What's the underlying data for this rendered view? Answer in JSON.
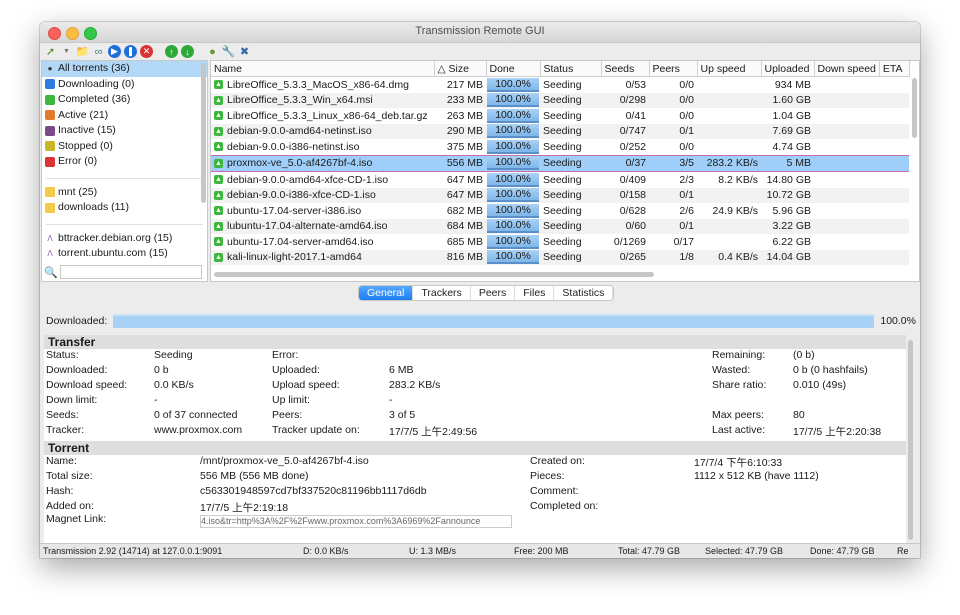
{
  "window": {
    "title": "Transmission Remote GUI"
  },
  "toolbar": {
    "icons": [
      "add-torrent-icon",
      "dropdown-arrow-icon",
      "add-folder-icon",
      "add-link-icon",
      "start-icon",
      "pause-icon",
      "remove-icon",
      "move-up-icon",
      "move-down-icon",
      "turtle-mode-icon",
      "connection-options-icon",
      "settings-icon"
    ]
  },
  "sidebar": {
    "status_filters": [
      {
        "label": "All torrents (36)",
        "icon": "all-icon",
        "color": "#333333"
      },
      {
        "label": "Downloading (0)",
        "icon": "download-icon",
        "color": "#2e7be0"
      },
      {
        "label": "Completed (36)",
        "icon": "completed-icon",
        "color": "#3cb93c"
      },
      {
        "label": "Active (21)",
        "icon": "active-icon",
        "color": "#e07b2e"
      },
      {
        "label": "Inactive (15)",
        "icon": "inactive-icon",
        "color": "#7a4a8a"
      },
      {
        "label": "Stopped (0)",
        "icon": "stopped-icon",
        "color": "#c8b52a"
      },
      {
        "label": "Error (0)",
        "icon": "error-icon",
        "color": "#d93333"
      }
    ],
    "folders": [
      {
        "label": "mnt (25)"
      },
      {
        "label": "downloads (11)"
      }
    ],
    "trackers": [
      {
        "label": "bttracker.debian.org (15)"
      },
      {
        "label": "torrent.ubuntu.com (15)"
      }
    ],
    "search": {
      "value": "",
      "placeholder": ""
    }
  },
  "torrents": {
    "columns": [
      "Name",
      "△ Size",
      "Done",
      "Status",
      "Seeds",
      "Peers",
      "Up speed",
      "Uploaded",
      "Down speed",
      "ETA"
    ],
    "rows": [
      {
        "name": "LibreOffice_5.3.3_MacOS_x86-64.dmg",
        "size": "217 MB",
        "done": "100.0%",
        "status": "Seeding",
        "seeds": "0/53",
        "peers": "0/0",
        "up": "",
        "uploaded": "934 MB",
        "down": "",
        "eta": ""
      },
      {
        "name": "LibreOffice_5.3.3_Win_x64.msi",
        "size": "233 MB",
        "done": "100.0%",
        "status": "Seeding",
        "seeds": "0/298",
        "peers": "0/0",
        "up": "",
        "uploaded": "1.60 GB",
        "down": "",
        "eta": ""
      },
      {
        "name": "LibreOffice_5.3.3_Linux_x86-64_deb.tar.gz",
        "size": "263 MB",
        "done": "100.0%",
        "status": "Seeding",
        "seeds": "0/41",
        "peers": "0/0",
        "up": "",
        "uploaded": "1.04 GB",
        "down": "",
        "eta": ""
      },
      {
        "name": "debian-9.0.0-amd64-netinst.iso",
        "size": "290 MB",
        "done": "100.0%",
        "status": "Seeding",
        "seeds": "0/747",
        "peers": "0/1",
        "up": "",
        "uploaded": "7.69 GB",
        "down": "",
        "eta": ""
      },
      {
        "name": "debian-9.0.0-i386-netinst.iso",
        "size": "375 MB",
        "done": "100.0%",
        "status": "Seeding",
        "seeds": "0/252",
        "peers": "0/0",
        "up": "",
        "uploaded": "4.74 GB",
        "down": "",
        "eta": ""
      },
      {
        "name": "proxmox-ve_5.0-af4267bf-4.iso",
        "size": "556 MB",
        "done": "100.0%",
        "status": "Seeding",
        "seeds": "0/37",
        "peers": "3/5",
        "up": "283.2 KB/s",
        "uploaded": "5 MB",
        "down": "",
        "eta": "",
        "selected": true
      },
      {
        "name": "debian-9.0.0-amd64-xfce-CD-1.iso",
        "size": "647 MB",
        "done": "100.0%",
        "status": "Seeding",
        "seeds": "0/409",
        "peers": "2/3",
        "up": "8.2 KB/s",
        "uploaded": "14.80 GB",
        "down": "",
        "eta": ""
      },
      {
        "name": "debian-9.0.0-i386-xfce-CD-1.iso",
        "size": "647 MB",
        "done": "100.0%",
        "status": "Seeding",
        "seeds": "0/158",
        "peers": "0/1",
        "up": "",
        "uploaded": "10.72 GB",
        "down": "",
        "eta": ""
      },
      {
        "name": "ubuntu-17.04-server-i386.iso",
        "size": "682 MB",
        "done": "100.0%",
        "status": "Seeding",
        "seeds": "0/628",
        "peers": "2/6",
        "up": "24.9 KB/s",
        "uploaded": "5.96 GB",
        "down": "",
        "eta": ""
      },
      {
        "name": "lubuntu-17.04-alternate-amd64.iso",
        "size": "684 MB",
        "done": "100.0%",
        "status": "Seeding",
        "seeds": "0/60",
        "peers": "0/1",
        "up": "",
        "uploaded": "3.22 GB",
        "down": "",
        "eta": ""
      },
      {
        "name": "ubuntu-17.04-server-amd64.iso",
        "size": "685 MB",
        "done": "100.0%",
        "status": "Seeding",
        "seeds": "0/1269",
        "peers": "0/17",
        "up": "",
        "uploaded": "6.22 GB",
        "down": "",
        "eta": ""
      },
      {
        "name": "kali-linux-light-2017.1-amd64",
        "size": "816 MB",
        "done": "100.0%",
        "status": "Seeding",
        "seeds": "0/265",
        "peers": "1/8",
        "up": "0.4 KB/s",
        "uploaded": "14.04 GB",
        "down": "",
        "eta": ""
      }
    ]
  },
  "tabs": [
    {
      "label": "General",
      "active": true
    },
    {
      "label": "Trackers",
      "active": false
    },
    {
      "label": "Peers",
      "active": false
    },
    {
      "label": "Files",
      "active": false
    },
    {
      "label": "Statistics",
      "active": false
    }
  ],
  "downloaded": {
    "label": "Downloaded:",
    "percent_text": "100.0%",
    "fraction": 1.0
  },
  "transfer": {
    "title": "Transfer",
    "status_label": "Status:",
    "status": "Seeding",
    "downloaded_label": "Downloaded:",
    "downloaded": "0 b",
    "download_speed_label": "Download speed:",
    "download_speed": "0.0 KB/s",
    "down_limit_label": "Down limit:",
    "down_limit": "-",
    "seeds_label": "Seeds:",
    "seeds": "0 of 37 connected",
    "tracker_label": "Tracker:",
    "tracker": "www.proxmox.com",
    "error_label": "Error:",
    "error": "",
    "uploaded_label": "Uploaded:",
    "uploaded": "6 MB",
    "upload_speed_label": "Upload speed:",
    "upload_speed": "283.2 KB/s",
    "up_limit_label": "Up limit:",
    "up_limit": "-",
    "peers_label": "Peers:",
    "peers": "3 of 5",
    "tracker_update_label": "Tracker update on:",
    "tracker_update": "17/7/5  上午2:49:56",
    "remaining_label": "Remaining:",
    "remaining": " (0 b)",
    "wasted_label": "Wasted:",
    "wasted": "0 b (0 hashfails)",
    "share_ratio_label": "Share ratio:",
    "share_ratio": "0.010 (49s)",
    "max_peers_label": "Max peers:",
    "max_peers": "80",
    "last_active_label": "Last active:",
    "last_active": "17/7/5  上午2:20:38"
  },
  "torrent": {
    "title": "Torrent",
    "name_label": "Name:",
    "name": "/mnt/proxmox-ve_5.0-af4267bf-4.iso",
    "total_size_label": "Total size:",
    "total_size": "556 MB (556 MB done)",
    "hash_label": "Hash:",
    "hash": "c563301948597cd7bf337520c81196bb1117d6db",
    "added_label": "Added on:",
    "added": "17/7/5  上午2:19:18",
    "magnet_label": "Magnet Link:",
    "magnet": "4.iso&tr=http%3A%2F%2Fwww.proxmox.com%3A6969%2Fannounce",
    "created_label": "Created on:",
    "created": "17/7/4  下午6:10:33",
    "pieces_label": "Pieces:",
    "pieces": "1112 x 512 KB (have 1112)",
    "comment_label": "Comment:",
    "comment": "",
    "completed_label": "Completed on:",
    "completed": ""
  },
  "statusbar": {
    "connection": "Transmission 2.92 (14714) at 127.0.0.1:9091",
    "down": "D: 0.0 KB/s",
    "up": "U: 1.3 MB/s",
    "free": "Free: 200 MB",
    "total": "Total: 47.79 GB",
    "selected": "Selected: 47.79 GB",
    "done": "Done: 47.79 GB",
    "extra": "Re"
  }
}
